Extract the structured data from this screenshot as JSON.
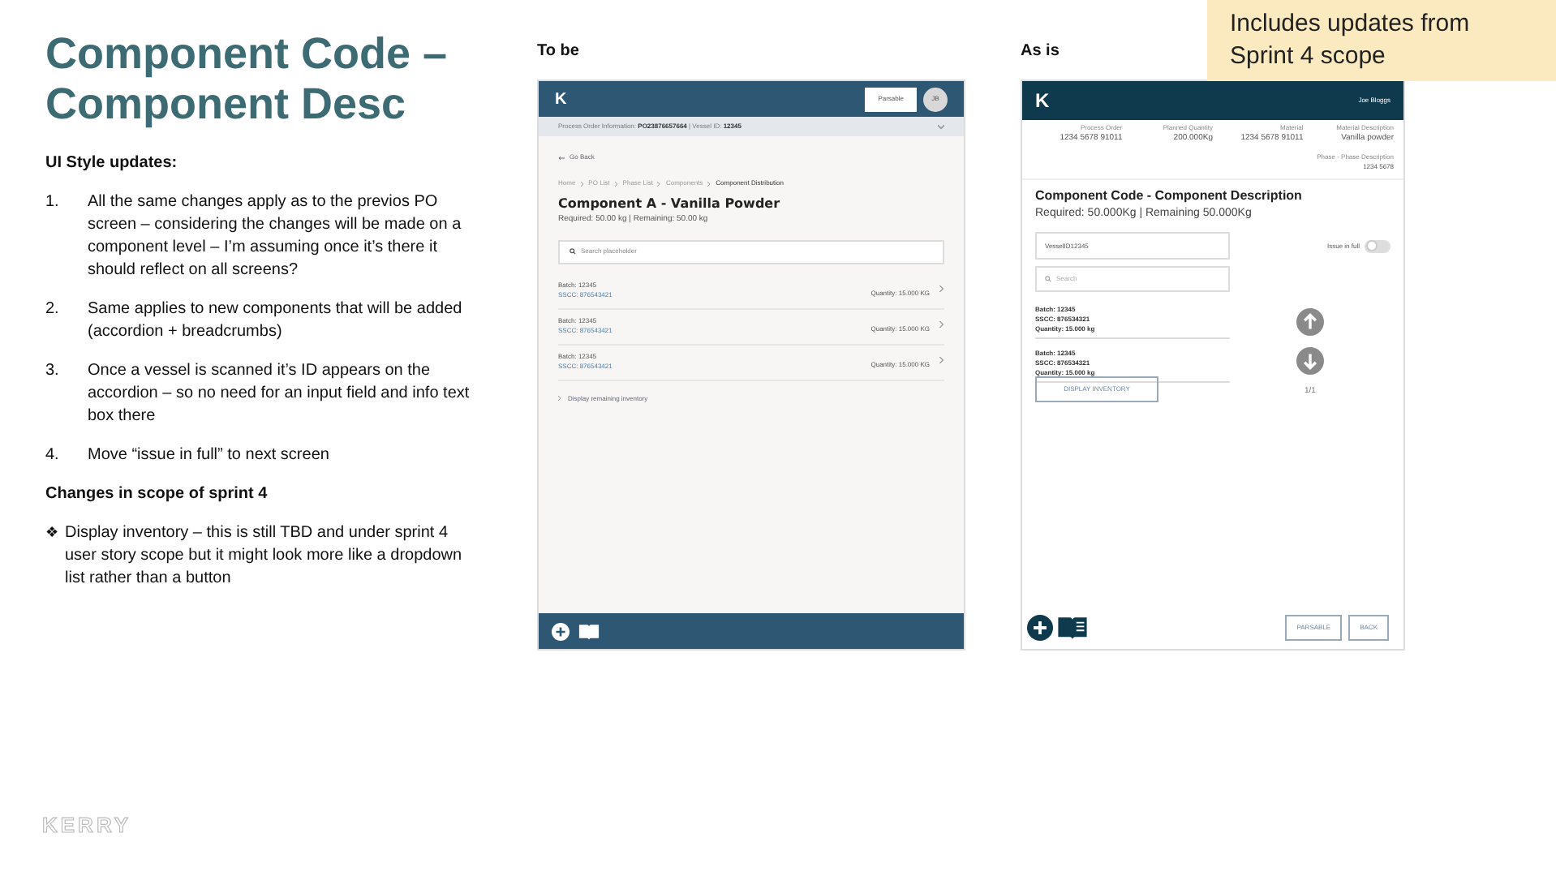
{
  "slide": {
    "title": "Component Code – Component Desc",
    "note": "Includes updates from Sprint 4 scope",
    "logo": "KERRY"
  },
  "notes": {
    "heading": "UI Style updates:",
    "items": [
      {
        "number": "1.",
        "text": "All the same changes apply as to the previos PO screen – considering the changes will be made on a component level – I’m assuming once it’s there it should reflect on all screens?"
      },
      {
        "number": "2.",
        "text": "Same applies to new components that will be added (accordion + breadcrumbs)"
      },
      {
        "number": "3.",
        "text": "Once a vessel is scanned it’s ID appears on the accordion – so no need for an input field and info text box there"
      },
      {
        "number": "4.",
        "text": "Move “issue in full” to next screen"
      }
    ],
    "scope_heading": "Changes in scope of sprint 4",
    "bullet": "❖",
    "scope_text": "Display inventory – this is still TBD and under sprint 4 user story scope but it might look more like a dropdown list rather than a button"
  },
  "to_be": {
    "label": "To be",
    "logo": "K",
    "parsable_button": "Parsable",
    "avatar": "JB",
    "info_label": "Process Order Information:",
    "info_value": "PO23876657664",
    "vessel_label": "| Vessel ID:",
    "vessel_value": "12345",
    "back_link": "Go Back",
    "breadcrumbs": [
      "Home",
      "PO List",
      "Phase List",
      "Components",
      "Component Distribution"
    ],
    "title": "Component A - Vanilla Powder",
    "subtitle": "Required: 50.00 kg | Remaining: 50.00 kg",
    "search": {
      "placeholder": "Search placeholder"
    },
    "rows": [
      {
        "batch": "Batch: 12345",
        "sscc": "SSCC: 876543421",
        "quantity": "Quantity: 15.000 KG"
      },
      {
        "batch": "Batch: 12345",
        "sscc": "SSCC: 876543421",
        "quantity": "Quantity: 15.000 KG"
      },
      {
        "batch": "Batch: 12345",
        "sscc": "SSCC: 876543421",
        "quantity": "Quantity: 15.000 KG"
      }
    ],
    "remaining_link": "Display remaining inventory"
  },
  "as_is": {
    "label": "As is",
    "logo": "K",
    "user": "Joe Bloggs",
    "info": [
      {
        "label": "Process Order",
        "value": "1234 5678 91011"
      },
      {
        "label": "Planned Quantity",
        "value": "200.000Kg"
      },
      {
        "label": "Material",
        "value": "1234 5678 91011"
      },
      {
        "label": "Material Description",
        "value": "Vanilla powder"
      }
    ],
    "phase": {
      "label": "Phase - Phase Description",
      "value": "1234 5678"
    },
    "title": "Component Code - Component Description",
    "subtitle": "Required: 50.000Kg |  Remaining 50.000Kg",
    "vessel_field": {
      "value": "VesselID12345"
    },
    "issue_in_full": {
      "label": "Issue in full",
      "on": false
    },
    "search": {
      "placeholder": "Search"
    },
    "batches": [
      {
        "batch": "Batch: 12345",
        "sscc": "SSCC: 876534321",
        "quantity": "Quantity: 15.000 kg"
      },
      {
        "batch": "Batch: 12345",
        "sscc": "SSCC: 876534321",
        "quantity": "Quantity: 15.000 kg"
      }
    ],
    "pager": "1/1",
    "inventory_button": "DISPLAY INVENTORY",
    "buttons": [
      "PARSABLE",
      "BACK"
    ]
  }
}
